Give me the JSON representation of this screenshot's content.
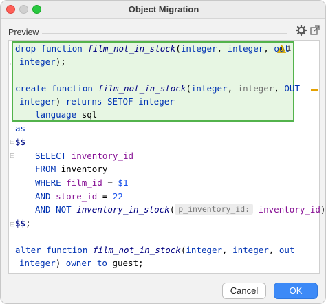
{
  "window": {
    "title": "Object Migration"
  },
  "preview": {
    "label": "Preview"
  },
  "warnings": {
    "count": "1"
  },
  "code": {
    "l1": {
      "kw1": "drop function ",
      "fn": "film_not_in_stock",
      "p1": "(",
      "t1": "integer",
      "c1": ", ",
      "t2": "integer",
      "c2": ", ",
      "t3": "out"
    },
    "l2": {
      "t1": "integer",
      "p1": ");"
    },
    "l3": {
      "kw1": "create function ",
      "fn": "film_not_in_stock",
      "p1": "(",
      "t1": "integer",
      "c1": ", ",
      "t2": "integer",
      "c2": ", ",
      "t3": "OUT"
    },
    "l4": {
      "t1": "integer",
      "p1": ") ",
      "kw1": "returns SETOF ",
      "t2": "integer"
    },
    "l5": {
      "kw1": "language ",
      "tx": "sql"
    },
    "l6": {
      "kw1": "as"
    },
    "l7": {
      "sym": "$$"
    },
    "l8": {
      "kw1": "SELECT ",
      "pu": "inventory_id"
    },
    "l9": {
      "kw1": "FROM ",
      "tx": "inventory"
    },
    "l10": {
      "kw1": "WHERE ",
      "pu": "film_id",
      "op": " = ",
      "nm": "$1"
    },
    "l11": {
      "kw1": "AND ",
      "pu": "store_id",
      "op": " = ",
      "nm": "22"
    },
    "l12": {
      "kw1": "AND NOT ",
      "fn": "inventory_in_stock",
      "p1": "(",
      "hint": "p_inventory_id:",
      "pu": "inventory_id",
      "p2": ");"
    },
    "l13": {
      "sym": "$$",
      "p1": ";"
    },
    "l14": {
      "kw1": "alter function ",
      "fn": "film_not_in_stock",
      "p1": "(",
      "t1": "integer",
      "c1": ", ",
      "t2": "integer",
      "c2": ", ",
      "t3": "out"
    },
    "l15": {
      "t1": "integer",
      "p1": ") ",
      "kw1": "owner to ",
      "tx": "guest",
      "p2": ";"
    }
  },
  "buttons": {
    "cancel": "Cancel",
    "ok": "OK"
  },
  "colors": {
    "highlight_border": "#53b34c",
    "highlight_bg": "#e7f6e3",
    "ok_button": "#3d8af7"
  }
}
